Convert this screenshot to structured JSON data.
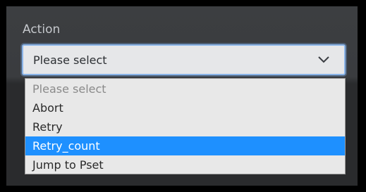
{
  "field": {
    "label": "Action",
    "selected_value": "Please select",
    "chevron_icon": "chevron-down-icon"
  },
  "dropdown": {
    "options": [
      {
        "label": "Please select",
        "state": "placeholder"
      },
      {
        "label": "Abort",
        "state": "normal"
      },
      {
        "label": "Retry",
        "state": "normal"
      },
      {
        "label": "Retry_count",
        "state": "highlighted"
      },
      {
        "label": "Jump to Pset",
        "state": "normal"
      }
    ]
  },
  "colors": {
    "highlight": "#1e90ff",
    "focus_border": "#8ab4e8",
    "panel_bg": "#3a3c3f"
  }
}
